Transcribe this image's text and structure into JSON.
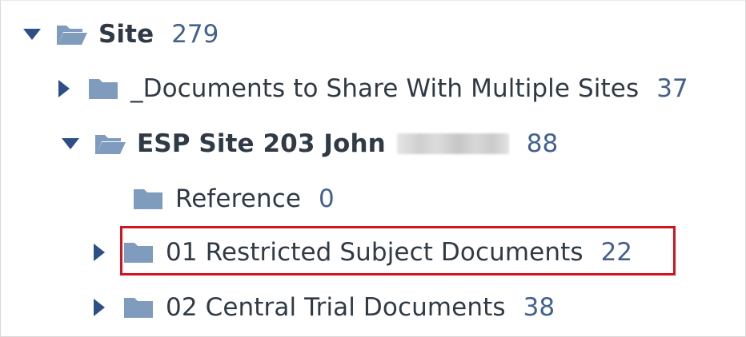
{
  "tree": {
    "root": {
      "label": "Site",
      "count": "279",
      "icon": "folder-open-icon",
      "expanded": true
    },
    "items": [
      {
        "label": "_Documents to Share With Multiple Sites",
        "count": "37",
        "icon": "folder-icon",
        "expanded": false
      },
      {
        "label": "ESP Site 203 John",
        "count": "88",
        "icon": "folder-open-icon",
        "expanded": true,
        "redacted_name": true
      },
      {
        "label": "Reference",
        "count": "0",
        "icon": "folder-icon",
        "has_children": false
      },
      {
        "label": "01 Restricted Subject Documents",
        "count": "22",
        "icon": "folder-icon",
        "expanded": false,
        "highlighted": true
      },
      {
        "label": "02 Central Trial Documents",
        "count": "38",
        "icon": "folder-icon",
        "expanded": false
      }
    ]
  },
  "colors": {
    "text": "#2f3a45",
    "count": "#44618c",
    "folder": "#7f9bbd",
    "caret": "#2d4f86",
    "highlight_border": "#d2141f"
  }
}
